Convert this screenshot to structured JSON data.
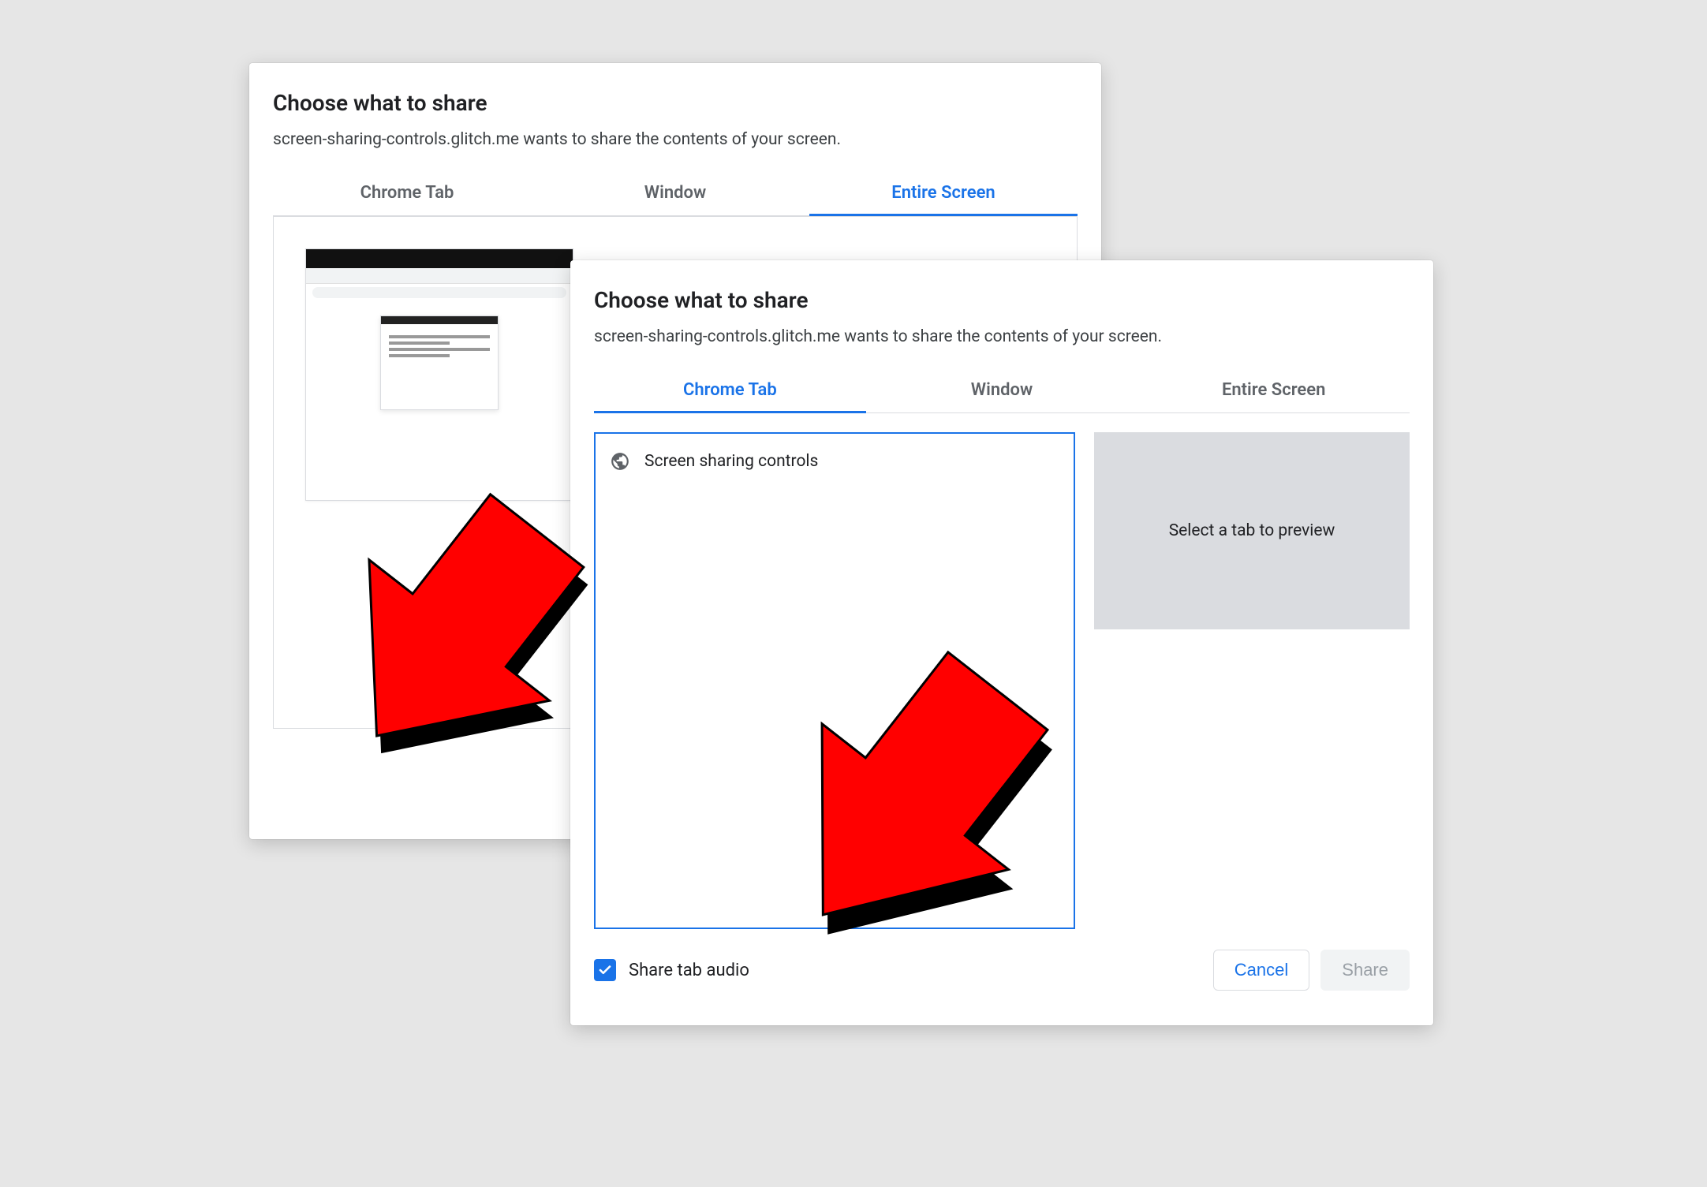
{
  "dialog_back": {
    "title": "Choose what to share",
    "subtitle": "screen-sharing-controls.glitch.me wants to share the contents of your screen.",
    "tabs": [
      {
        "label": "Chrome Tab",
        "active": false
      },
      {
        "label": "Window",
        "active": false
      },
      {
        "label": "Entire Screen",
        "active": true
      }
    ]
  },
  "dialog_front": {
    "title": "Choose what to share",
    "subtitle": "screen-sharing-controls.glitch.me wants to share the contents of your screen.",
    "tabs": [
      {
        "label": "Chrome Tab",
        "active": true
      },
      {
        "label": "Window",
        "active": false
      },
      {
        "label": "Entire Screen",
        "active": false
      }
    ],
    "tab_items": [
      {
        "label": "Screen sharing controls"
      }
    ],
    "preview_placeholder": "Select a tab to preview",
    "share_audio_label": "Share tab audio",
    "share_audio_checked": true,
    "cancel_label": "Cancel",
    "share_label": "Share"
  }
}
